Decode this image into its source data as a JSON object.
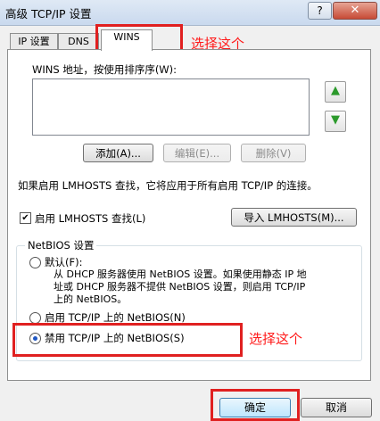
{
  "window": {
    "title": "高级 TCP/IP 设置",
    "help": "?",
    "close": "✕"
  },
  "tabs": [
    {
      "label": "IP 设置"
    },
    {
      "label": "DNS"
    },
    {
      "label": "WINS"
    }
  ],
  "annotations": {
    "tab_note": "选择这个",
    "option_note": "选择这个"
  },
  "wins": {
    "list_label": "WINS 地址，按使用排序序(W):",
    "up_icon": "arrow-up-icon",
    "down_icon": "arrow-down-icon",
    "add": "添加(A)...",
    "edit": "编辑(E)...",
    "remove": "删除(V)"
  },
  "lmhosts": {
    "description": "如果启用 LMHOSTS 查找，它将应用于所有启用 TCP/IP 的连接。",
    "enable_label": "启用 LMHOSTS 查找(L)",
    "enable_checked": true,
    "import": "导入 LMHOSTS(M)..."
  },
  "netbios": {
    "group_title": "NetBIOS 设置",
    "options": [
      {
        "label": "默认(F):",
        "selected": false
      },
      {
        "label": "启用 TCP/IP 上的 NetBIOS(N)",
        "selected": false
      },
      {
        "label": "禁用 TCP/IP 上的 NetBIOS(S)",
        "selected": true
      }
    ],
    "default_desc_1": "从 DHCP 服务器使用 NetBIOS 设置。如果使用静态 IP 地",
    "default_desc_2": "址或 DHCP 服务器不提供 NetBIOS 设置，则启用 TCP/IP",
    "default_desc_3": "上的 NetBIOS。"
  },
  "footer": {
    "ok": "确定",
    "cancel": "取消"
  }
}
